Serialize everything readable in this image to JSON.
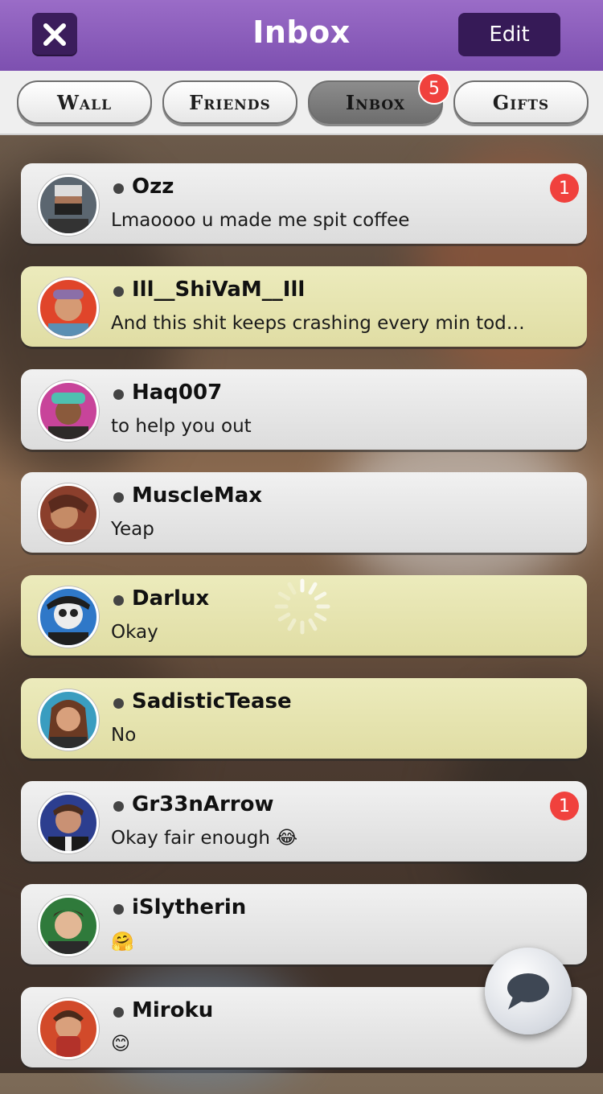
{
  "header": {
    "title": "Inbox",
    "edit_label": "Edit"
  },
  "tabs": [
    {
      "label": "Wall",
      "active": false
    },
    {
      "label": "Friends",
      "active": false
    },
    {
      "label": "Inbox",
      "active": true,
      "badge": "5"
    },
    {
      "label": "Gifts",
      "active": false
    }
  ],
  "messages": [
    {
      "name": "Ozz",
      "preview": "Lmaoooo u made me spit coffee",
      "unread": "1",
      "style": "grey"
    },
    {
      "name": "Ill__ShiVaM__Ill",
      "preview": "And this shit keeps crashing every min tod…",
      "style": "yellow"
    },
    {
      "name": "Haq007",
      "preview": "to help you out",
      "style": "grey"
    },
    {
      "name": "MuscleMax",
      "preview": "Yeap",
      "style": "grey"
    },
    {
      "name": "Darlux",
      "preview": "Okay",
      "style": "yellow"
    },
    {
      "name": "SadisticTease",
      "preview": "No",
      "style": "yellow"
    },
    {
      "name": "Gr33nArrow",
      "preview": "Okay fair enough 😂",
      "unread": "1",
      "style": "grey"
    },
    {
      "name": "iSlytherin",
      "preview": "🤗",
      "style": "grey"
    },
    {
      "name": "Miroku",
      "preview": "😊",
      "style": "grey"
    }
  ],
  "colors": {
    "header": "#7d50b0",
    "badge": "#f0413d",
    "yellow_row": "#e6e3ad"
  }
}
